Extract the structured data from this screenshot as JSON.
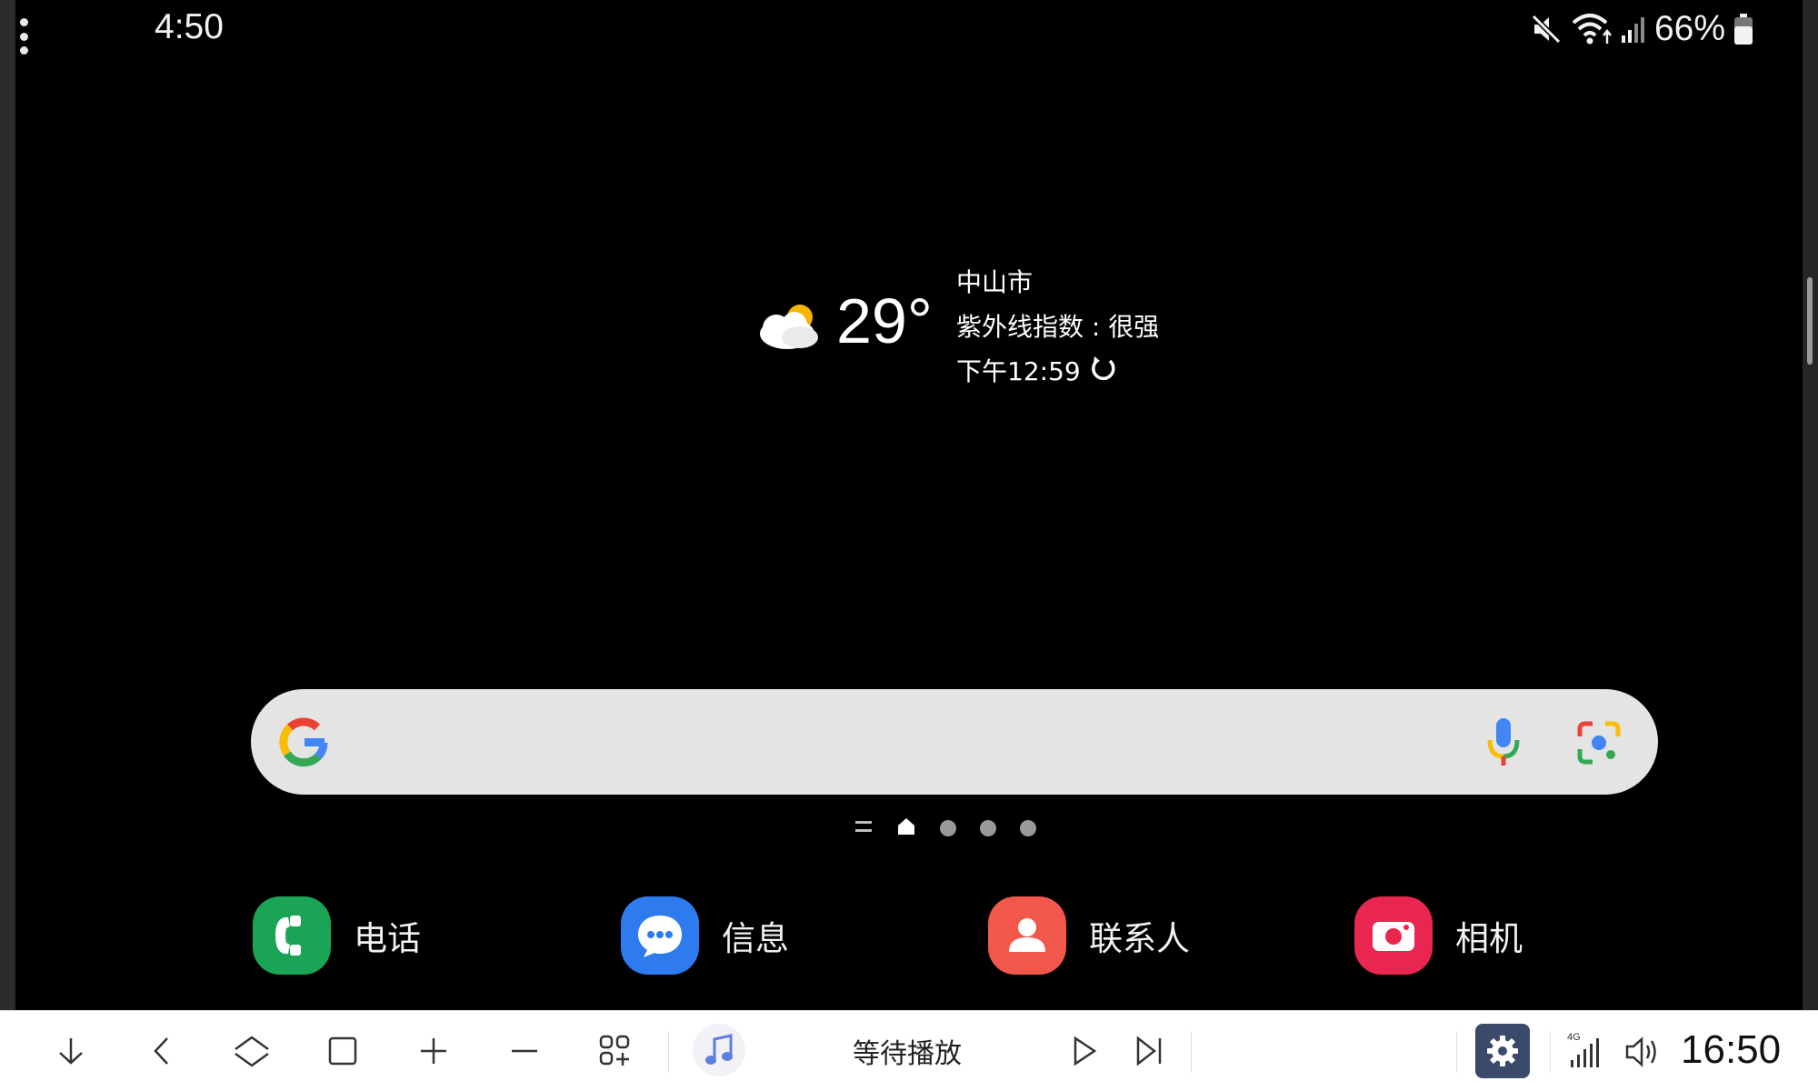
{
  "status_bar": {
    "time": "4:50",
    "battery": "66%",
    "icons": [
      "mute-icon",
      "wifi-icon",
      "cellular-signal-icon",
      "battery-icon"
    ]
  },
  "weather": {
    "temperature": "29°",
    "city": "中山市",
    "uv_index": "紫外线指数 : 很强",
    "updated_time": "下午12:59",
    "icon": "partly-cloudy-icon"
  },
  "search_bar": {
    "icons": [
      "google-logo-icon",
      "microphone-icon",
      "google-lens-icon"
    ]
  },
  "page_indicator": {
    "pages": 4,
    "active": 0
  },
  "dock": {
    "apps": [
      {
        "label": "电话",
        "icon": "phone-icon",
        "color": "#1aa455"
      },
      {
        "label": "信息",
        "icon": "messages-icon",
        "color": "#2e7bf0"
      },
      {
        "label": "联系人",
        "icon": "contacts-icon",
        "color": "#f2574b"
      },
      {
        "label": "相机",
        "icon": "camera-icon",
        "color": "#e8264f"
      }
    ]
  },
  "control_bar": {
    "playback_status": "等待播放",
    "clock": "16:50",
    "network_label": "4G",
    "buttons": [
      "collapse-icon",
      "back-icon",
      "home-icon",
      "recents-icon",
      "volume-up-icon",
      "volume-down-icon",
      "app-grid-icon",
      "music-note-icon",
      "play-icon",
      "next-track-icon",
      "settings-icon",
      "signal-icon",
      "volume-icon"
    ]
  }
}
